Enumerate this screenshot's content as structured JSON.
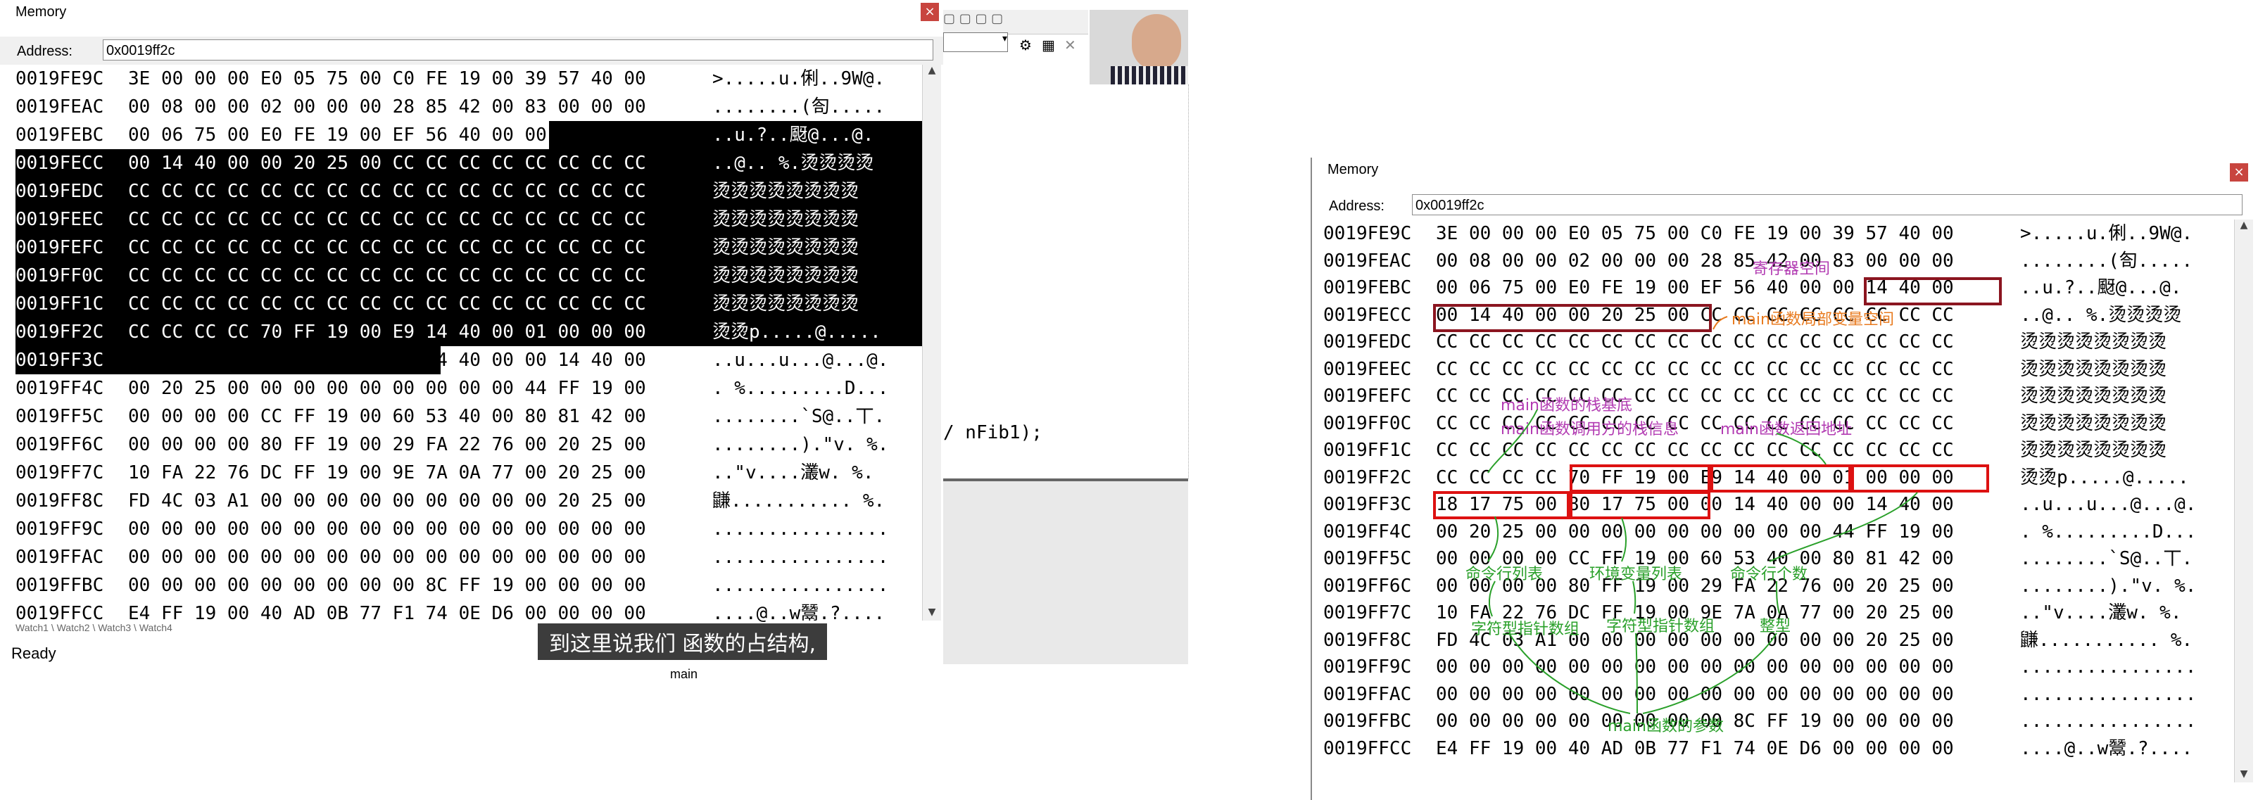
{
  "left_window": {
    "title": "Memory",
    "address_label": "Address:",
    "address_value": "0x0019ff2c",
    "rows": [
      {
        "addr": "0019FE9C",
        "hex": "3E 00 00 00 E0 05 75 00 C0 FE 19 00 39 57 40 00",
        "ascii": ">.....u.俐..9W@."
      },
      {
        "addr": "0019FEAC",
        "hex": "00 08 00 00 02 00 00 00 28 85 42 00 83 00 00 00",
        "ascii": "........(匌....."
      },
      {
        "addr": "0019FEBC",
        "hex": "00 06 75 00 E0 FE 19 00 EF 56 40 00 00 14 40 00",
        "ascii": "..u.?..颬@...@."
      },
      {
        "addr": "0019FECC",
        "hex": "00 14 40 00 00 20 25 00 CC CC CC CC CC CC CC CC",
        "ascii": "..@.. %.烫烫烫烫"
      },
      {
        "addr": "0019FEDC",
        "hex": "CC CC CC CC CC CC CC CC CC CC CC CC CC CC CC CC",
        "ascii": "烫烫烫烫烫烫烫烫"
      },
      {
        "addr": "0019FEEC",
        "hex": "CC CC CC CC CC CC CC CC CC CC CC CC CC CC CC CC",
        "ascii": "烫烫烫烫烫烫烫烫"
      },
      {
        "addr": "0019FEFC",
        "hex": "CC CC CC CC CC CC CC CC CC CC CC CC CC CC CC CC",
        "ascii": "烫烫烫烫烫烫烫烫"
      },
      {
        "addr": "0019FF0C",
        "hex": "CC CC CC CC CC CC CC CC CC CC CC CC CC CC CC CC",
        "ascii": "烫烫烫烫烫烫烫烫"
      },
      {
        "addr": "0019FF1C",
        "hex": "CC CC CC CC CC CC CC CC CC CC CC CC CC CC CC CC",
        "ascii": "烫烫烫烫烫烫烫烫"
      },
      {
        "addr": "0019FF2C",
        "hex": "CC CC CC CC 70 FF 19 00 E9 14 40 00 01 00 00 00",
        "ascii": "烫烫p.....@....."
      },
      {
        "addr": "0019FF3C",
        "hex": "18 17 75 00 80 17 75 00 00 14 40 00 00 14 40 00",
        "ascii": "..u...u...@...@."
      },
      {
        "addr": "0019FF4C",
        "hex": "00 20 25 00 00 00 00 00 00 00 00 00 44 FF 19 00",
        "ascii": ". %.........D..."
      },
      {
        "addr": "0019FF5C",
        "hex": "00 00 00 00 CC FF 19 00 60 53 40 00 80 81 42 00",
        "ascii": "........`S@..丅."
      },
      {
        "addr": "0019FF6C",
        "hex": "00 00 00 00 80 FF 19 00 29 FA 22 76 00 20 25 00",
        "ascii": "........).\"v. %."
      },
      {
        "addr": "0019FF7C",
        "hex": "10 FA 22 76 DC FF 19 00 9E 7A 0A 77 00 20 25 00",
        "ascii": "..\"v....灇w. %."
      },
      {
        "addr": "0019FF8C",
        "hex": "FD 4C 03 A1 00 00 00 00 00 00 00 00 00 20 25 00",
        "ascii": "鼸........... %."
      },
      {
        "addr": "0019FF9C",
        "hex": "00 00 00 00 00 00 00 00 00 00 00 00 00 00 00 00",
        "ascii": "................"
      },
      {
        "addr": "0019FFAC",
        "hex": "00 00 00 00 00 00 00 00 00 00 00 00 00 00 00 00",
        "ascii": "................"
      },
      {
        "addr": "0019FFBC",
        "hex": "00 00 00 00 00 00 00 00 00 8C FF 19 00 00 00 00",
        "ascii": "................"
      },
      {
        "addr": "0019FFCC",
        "hex": "E4 FF 19 00 40 AD 0B 77 F1 74 0E D6 00 00 00 00",
        "ascii": "....@..w鬵.?...."
      }
    ],
    "code_fragment": "/ nFib1);",
    "status_text": "Ready",
    "caption": "到这里说我们 函数的占结构,",
    "tab_label": "main",
    "bottom_tabs": "Watch1 \\ Watch2 \\ Watch3 \\ Watch4"
  },
  "right_window": {
    "title": "Memory",
    "address_label": "Address:",
    "address_value": "0x0019ff2c",
    "rows": [
      {
        "addr": "0019FE9C",
        "hex": "3E 00 00 00 E0 05 75 00 C0 FE 19 00 39 57 40 00",
        "ascii": ">.....u.俐..9W@."
      },
      {
        "addr": "0019FEAC",
        "hex": "00 08 00 00 02 00 00 00 28 85 42 00 83 00 00 00",
        "ascii": "........(匌....."
      },
      {
        "addr": "0019FEBC",
        "hex": "00 06 75 00 E0 FE 19 00 EF 56 40 00 00 14 40 00",
        "ascii": "..u.?..颬@...@."
      },
      {
        "addr": "0019FECC",
        "hex": "00 14 40 00 00 20 25 00 CC CC CC CC CC CC CC CC",
        "ascii": "..@.. %.烫烫烫烫"
      },
      {
        "addr": "0019FEDC",
        "hex": "CC CC CC CC CC CC CC CC CC CC CC CC CC CC CC CC",
        "ascii": "烫烫烫烫烫烫烫烫"
      },
      {
        "addr": "0019FEEC",
        "hex": "CC CC CC CC CC CC CC CC CC CC CC CC CC CC CC CC",
        "ascii": "烫烫烫烫烫烫烫烫"
      },
      {
        "addr": "0019FEFC",
        "hex": "CC CC CC CC CC CC CC CC CC CC CC CC CC CC CC CC",
        "ascii": "烫烫烫烫烫烫烫烫"
      },
      {
        "addr": "0019FF0C",
        "hex": "CC CC CC CC CC CC CC CC CC CC CC CC CC CC CC CC",
        "ascii": "烫烫烫烫烫烫烫烫"
      },
      {
        "addr": "0019FF1C",
        "hex": "CC CC CC CC CC CC CC CC CC CC CC CC CC CC CC CC",
        "ascii": "烫烫烫烫烫烫烫烫"
      },
      {
        "addr": "0019FF2C",
        "hex": "CC CC CC CC 70 FF 19 00 E9 14 40 00 01 00 00 00",
        "ascii": "烫烫p.....@....."
      },
      {
        "addr": "0019FF3C",
        "hex": "18 17 75 00 80 17 75 00 00 14 40 00 00 14 40 00",
        "ascii": "..u...u...@...@."
      },
      {
        "addr": "0019FF4C",
        "hex": "00 20 25 00 00 00 00 00 00 00 00 00 44 FF 19 00",
        "ascii": ". %.........D..."
      },
      {
        "addr": "0019FF5C",
        "hex": "00 00 00 00 CC FF 19 00 60 53 40 00 80 81 42 00",
        "ascii": "........`S@..丅."
      },
      {
        "addr": "0019FF6C",
        "hex": "00 00 00 00 80 FF 19 00 29 FA 22 76 00 20 25 00",
        "ascii": "........).\"v. %."
      },
      {
        "addr": "0019FF7C",
        "hex": "10 FA 22 76 DC FF 19 00 9E 7A 0A 77 00 20 25 00",
        "ascii": "..\"v....灇w. %."
      },
      {
        "addr": "0019FF8C",
        "hex": "FD 4C 03 A1 00 00 00 00 00 00 00 00 00 20 25 00",
        "ascii": "鼸........... %."
      },
      {
        "addr": "0019FF9C",
        "hex": "00 00 00 00 00 00 00 00 00 00 00 00 00 00 00 00",
        "ascii": "................"
      },
      {
        "addr": "0019FFAC",
        "hex": "00 00 00 00 00 00 00 00 00 00 00 00 00 00 00 00",
        "ascii": "................"
      },
      {
        "addr": "0019FFBC",
        "hex": "00 00 00 00 00 00 00 00 00 8C FF 19 00 00 00 00",
        "ascii": "................"
      },
      {
        "addr": "0019FFCC",
        "hex": "E4 FF 19 00 40 AD 0B 77 F1 74 0E D6 00 00 00 00",
        "ascii": "....@..w鬵.?...."
      }
    ],
    "annotations": {
      "register_space": "寄存器空间",
      "main_local_space": "main函数局部变量空间",
      "main_stack_base": "main函数的栈基底",
      "caller_stack_info": "main函数调用方的栈信息",
      "main_return_addr": "main函数返回地址",
      "cmd_list": "命令行列表",
      "env_list": "环境变量列表",
      "cmd_count": "命令行个数",
      "char_ptr_array": "字符型指针数组",
      "char_ptr_array2": "字符型指针数组",
      "integer": "整型",
      "main_params": "main函数的参数"
    },
    "colors": {
      "purple": "#b23bb2",
      "orange": "#e87a1e",
      "green": "#2aa02a",
      "red": "#d11111",
      "dark_red": "#8b1520"
    }
  }
}
